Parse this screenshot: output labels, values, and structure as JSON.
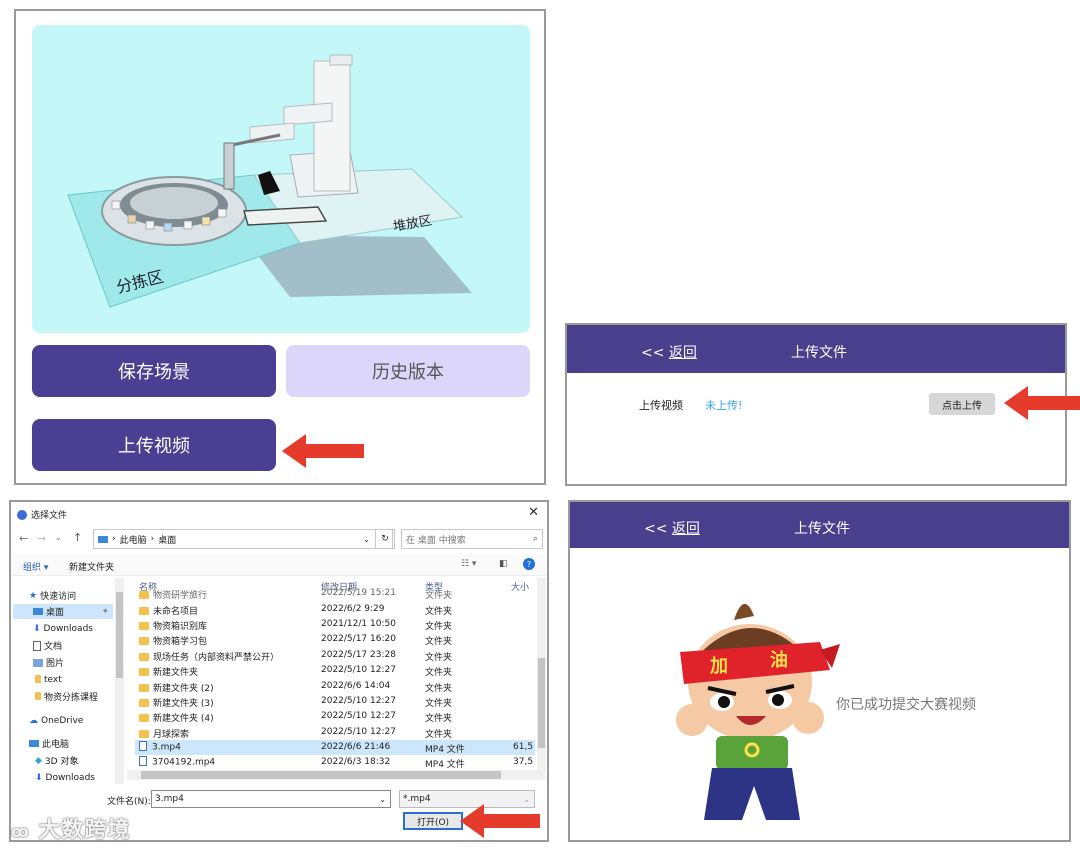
{
  "scene_panel": {
    "labels": {
      "sorting_area": "分拣区",
      "stacking_area": "堆放区"
    },
    "buttons": {
      "save_scene": "保存场景",
      "history_version": "历史版本",
      "upload_video": "上传视频"
    }
  },
  "upload_panel": {
    "header": {
      "back_arrows": "<<",
      "back_label": "返回",
      "title": "上传文件"
    },
    "row": {
      "label": "上传视频",
      "status": "未上传!",
      "button": "点击上传"
    },
    "colors": {
      "header": "#493f8d",
      "status": "#3aa4e6"
    }
  },
  "file_dialog": {
    "title": "选择文件",
    "address": {
      "path_root": "此电脑",
      "path_leaf": "桌面",
      "search_placeholder": "在 桌面 中搜索"
    },
    "toolbar": {
      "organize": "组织 ▾",
      "new_folder": "新建文件夹"
    },
    "nav_tree": [
      {
        "label": "快速访问",
        "icon": "star-icon"
      },
      {
        "label": "桌面",
        "icon": "desktop-icon",
        "selected": true
      },
      {
        "label": "Downloads",
        "icon": "download-icon"
      },
      {
        "label": "文档",
        "icon": "document-icon"
      },
      {
        "label": "图片",
        "icon": "picture-icon"
      },
      {
        "label": "text",
        "icon": "folder-icon"
      },
      {
        "label": "物资分拣课程",
        "icon": "folder-icon"
      },
      {
        "label": "OneDrive",
        "icon": "cloud-icon"
      },
      {
        "label": "此电脑",
        "icon": "computer-icon"
      },
      {
        "label": "3D 对象",
        "icon": "cube-icon"
      },
      {
        "label": "Downloads",
        "icon": "download-icon"
      }
    ],
    "columns": {
      "name": "名称",
      "modified": "修改日期",
      "type": "类型",
      "size": "大小"
    },
    "files": [
      {
        "name": "物资研学旅行",
        "date": "2022/5/19 15:21",
        "type": "文件夹",
        "size": "",
        "kind": "folder"
      },
      {
        "name": "未命名项目",
        "date": "2022/6/2 9:29",
        "type": "文件夹",
        "size": "",
        "kind": "folder"
      },
      {
        "name": "物资箱识别库",
        "date": "2021/12/1 10:50",
        "type": "文件夹",
        "size": "",
        "kind": "folder"
      },
      {
        "name": "物资箱学习包",
        "date": "2022/5/17 16:20",
        "type": "文件夹",
        "size": "",
        "kind": "folder"
      },
      {
        "name": "现场任务（内部资料严禁公开）",
        "date": "2022/5/17 23:28",
        "type": "文件夹",
        "size": "",
        "kind": "folder"
      },
      {
        "name": "新建文件夹",
        "date": "2022/5/10 12:27",
        "type": "文件夹",
        "size": "",
        "kind": "folder"
      },
      {
        "name": "新建文件夹 (2)",
        "date": "2022/6/6 14:04",
        "type": "文件夹",
        "size": "",
        "kind": "folder"
      },
      {
        "name": "新建文件夹 (3)",
        "date": "2022/5/10 12:27",
        "type": "文件夹",
        "size": "",
        "kind": "folder"
      },
      {
        "name": "新建文件夹 (4)",
        "date": "2022/5/10 12:27",
        "type": "文件夹",
        "size": "",
        "kind": "folder"
      },
      {
        "name": "月球探索",
        "date": "2022/5/10 12:27",
        "type": "文件夹",
        "size": "",
        "kind": "folder"
      },
      {
        "name": "3.mp4",
        "date": "2022/6/6 21:46",
        "type": "MP4 文件",
        "size": "61,5",
        "kind": "mp4",
        "selected": true
      },
      {
        "name": "3704192.mp4",
        "date": "2022/6/3 18:32",
        "type": "MP4 文件",
        "size": "37,5",
        "kind": "mp4"
      }
    ],
    "footer": {
      "filename_label": "文件名(N):",
      "filename_value": "3.mp4",
      "filter_value": "*.mp4",
      "open_button": "打开(O)"
    },
    "watermark": "大数跨境"
  },
  "success_panel": {
    "header": {
      "back_arrows": "<<",
      "back_label": "返回",
      "title": "上传文件"
    },
    "mascot_headband": {
      "left": "加",
      "right": "油"
    },
    "message": "你已成功提交大赛视频"
  }
}
